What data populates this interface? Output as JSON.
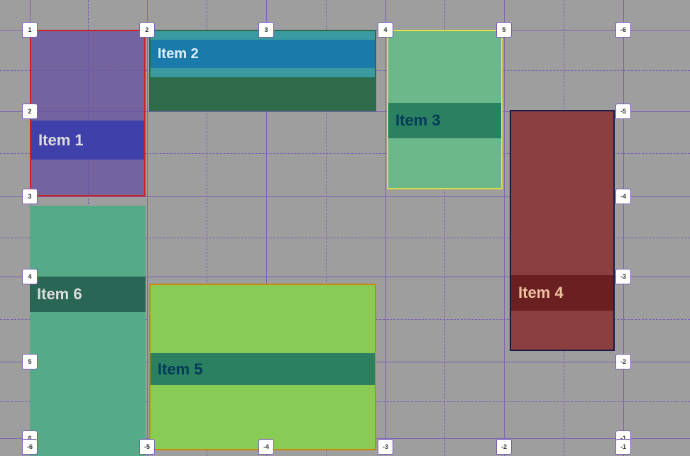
{
  "grid": {
    "v_solid": [
      42,
      207,
      375,
      543,
      710,
      878
    ],
    "h_solid": [
      42,
      157,
      277,
      390,
      510,
      618
    ],
    "v_dashed": [
      124,
      291,
      459,
      626,
      794
    ],
    "h_dashed": [
      99,
      216,
      335,
      450,
      566
    ],
    "top_labels": [
      "1",
      "2",
      "3",
      "4",
      "5",
      "6"
    ],
    "bottom_labels": [
      "-6",
      "-5",
      "-4",
      "-3",
      "-2",
      "-1"
    ],
    "left_labels": [
      "1",
      "2",
      "3",
      "4",
      "5",
      "6"
    ],
    "right_labels": [
      "-6",
      "-5",
      "-4",
      "-3",
      "-2",
      "-1"
    ]
  },
  "items": {
    "item1": {
      "label": "Item 1"
    },
    "item2": {
      "label": "Item 2"
    },
    "item3": {
      "label": "Item 3"
    },
    "item4": {
      "label": "Item 4"
    },
    "item5": {
      "label": "Item 5"
    },
    "item6": {
      "label": "Item 6"
    }
  }
}
